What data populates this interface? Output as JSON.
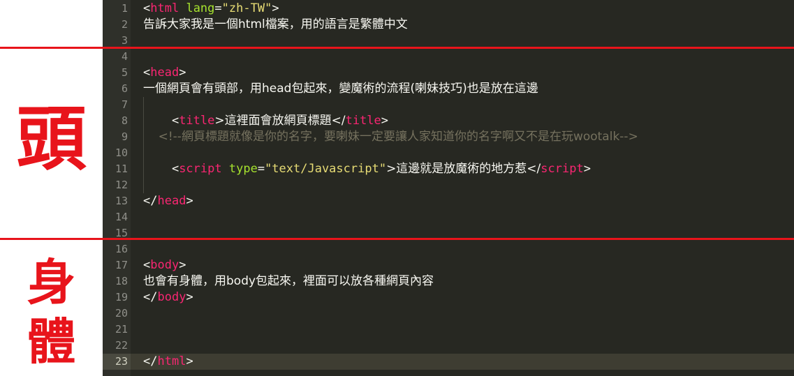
{
  "side_labels": {
    "head": "頭",
    "body_char1": "身",
    "body_char2": "體"
  },
  "colors": {
    "divider": "#e8141b",
    "editor_bg": "#272822",
    "tag": "#f92672",
    "attr": "#a6e22e",
    "string": "#e6db74",
    "comment": "#75715e"
  },
  "lines": [
    {
      "n": "1",
      "parts": [
        {
          "t": "<",
          "c": "plain"
        },
        {
          "t": "html",
          "c": "tag"
        },
        {
          "t": " ",
          "c": "plain"
        },
        {
          "t": "lang",
          "c": "attr"
        },
        {
          "t": "=",
          "c": "plain"
        },
        {
          "t": "\"zh-TW\"",
          "c": "str"
        },
        {
          "t": ">",
          "c": "plain"
        }
      ]
    },
    {
      "n": "2",
      "parts": [
        {
          "t": "告訴大家我是一個html檔案，用的語言是繁體中文",
          "c": "plain zh"
        }
      ]
    },
    {
      "n": "3",
      "parts": []
    },
    {
      "n": "4",
      "parts": []
    },
    {
      "n": "5",
      "parts": [
        {
          "t": "<",
          "c": "plain"
        },
        {
          "t": "head",
          "c": "tag"
        },
        {
          "t": ">",
          "c": "plain"
        }
      ]
    },
    {
      "n": "6",
      "parts": [
        {
          "t": "一個網頁會有頭部，用head包起來，變魔術的流程(喇妹技巧)也是放在這邊",
          "c": "plain zh"
        }
      ]
    },
    {
      "n": "7",
      "parts": []
    },
    {
      "n": "8",
      "parts": [
        {
          "t": "    <",
          "c": "plain"
        },
        {
          "t": "title",
          "c": "tag"
        },
        {
          "t": ">這裡面會放網頁標題</",
          "c": "plain zh"
        },
        {
          "t": "title",
          "c": "tag"
        },
        {
          "t": ">",
          "c": "plain"
        }
      ]
    },
    {
      "n": "9",
      "parts": [
        {
          "t": "    <!--網頁標題就像是你的名字，要喇妹一定要讓人家知道你的名字啊又不是在玩wootalk-->",
          "c": "comment zh"
        }
      ]
    },
    {
      "n": "10",
      "parts": []
    },
    {
      "n": "11",
      "parts": [
        {
          "t": "    <",
          "c": "plain"
        },
        {
          "t": "script",
          "c": "tag"
        },
        {
          "t": " ",
          "c": "plain"
        },
        {
          "t": "type",
          "c": "attr"
        },
        {
          "t": "=",
          "c": "plain"
        },
        {
          "t": "\"text/Javascript\"",
          "c": "str"
        },
        {
          "t": ">這邊就是放魔術的地方惹</",
          "c": "plain zh"
        },
        {
          "t": "script",
          "c": "tag"
        },
        {
          "t": ">",
          "c": "plain"
        }
      ]
    },
    {
      "n": "12",
      "parts": []
    },
    {
      "n": "13",
      "parts": [
        {
          "t": "</",
          "c": "plain"
        },
        {
          "t": "head",
          "c": "tag"
        },
        {
          "t": ">",
          "c": "plain"
        }
      ]
    },
    {
      "n": "14",
      "parts": []
    },
    {
      "n": "15",
      "parts": []
    },
    {
      "n": "16",
      "parts": []
    },
    {
      "n": "17",
      "parts": [
        {
          "t": "<",
          "c": "plain"
        },
        {
          "t": "body",
          "c": "tag"
        },
        {
          "t": ">",
          "c": "plain"
        }
      ]
    },
    {
      "n": "18",
      "parts": [
        {
          "t": "也會有身體，用body包起來，裡面可以放各種網頁內容",
          "c": "plain zh"
        }
      ]
    },
    {
      "n": "19",
      "parts": [
        {
          "t": "</",
          "c": "plain"
        },
        {
          "t": "body",
          "c": "tag"
        },
        {
          "t": ">",
          "c": "plain"
        }
      ]
    },
    {
      "n": "20",
      "parts": []
    },
    {
      "n": "21",
      "parts": []
    },
    {
      "n": "22",
      "parts": []
    },
    {
      "n": "23",
      "parts": [
        {
          "t": "</",
          "c": "plain"
        },
        {
          "t": "html",
          "c": "tag"
        },
        {
          "t": ">",
          "c": "plain"
        }
      ],
      "current": true
    }
  ]
}
